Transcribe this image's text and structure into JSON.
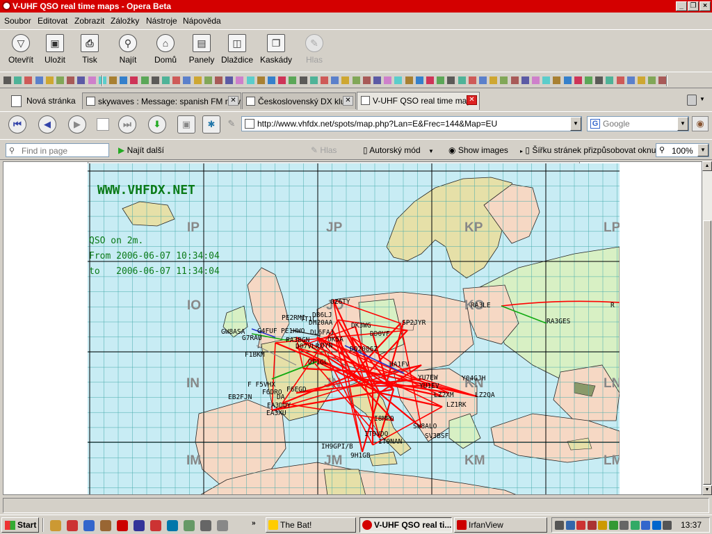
{
  "window": {
    "title": "V-UHF QSO real time maps - Opera Beta"
  },
  "menu": [
    "Soubor",
    "Editovat",
    "Zobrazit",
    "Záložky",
    "Nástroje",
    "Nápověda"
  ],
  "toolbar": {
    "open": "Otevřít",
    "save": "Uložit",
    "print": "Tisk",
    "find": "Najít",
    "home": "Domů",
    "panels": "Panely",
    "tile": "Dlaždice",
    "cascade": "Kaskády",
    "voice": "Hlas"
  },
  "tabs": {
    "new_page": "Nová stránka",
    "items": [
      {
        "title": "skywaves : Message: spanish FM now"
      },
      {
        "title": "Československý DX klub"
      },
      {
        "title": "V-UHF QSO real time maps"
      }
    ]
  },
  "address": {
    "url": "http://www.vhfdx.net/spots/map.php?Lan=E&Frec=144&Map=EU"
  },
  "search": {
    "engine": "Google"
  },
  "findbar": {
    "placeholder": "Find in page",
    "find_next": "Najít další",
    "voice": "Hlas",
    "author_mode": "Autorský mód",
    "show_images": "Show images",
    "fit_width": "Šířku stránek přizpůsobovat oknu",
    "zoom": "100%"
  },
  "map": {
    "site": "WWW.VHFDX.NET",
    "qso_line": "QSO on 2m.",
    "from_line": "From 2006-06-07 10:34:04",
    "to_line": "to   2006-06-07 11:34:04",
    "locators": [
      "IP",
      "JP",
      "KP",
      "LP",
      "IO",
      "JO",
      "KO",
      "IN",
      "JN",
      "KN",
      "LN",
      "IM",
      "JM",
      "KM",
      "LM"
    ],
    "stations": [
      "OZ6TY",
      "RA3LE",
      "R",
      "RA3GES",
      "PE2RMI",
      "TT1C",
      "DB6LJ",
      "DH20AA",
      "DK3WG",
      "DD0VF",
      "SP2JYR",
      "GW8ASA",
      "G4FUF",
      "PE1HWO",
      "DL6FAJ",
      "G7RAU",
      "PA3BGN",
      "OK5A",
      "D07VLR",
      "DYN",
      "DQ2006Z",
      "F1BKM",
      "DF1GL",
      "HA1FV",
      "YU7EW",
      "Y04GJH",
      "F F5VHX",
      "F6DRO",
      "F6EGD",
      "DA",
      "YU1EV",
      "EB2FJN",
      "EA3DUY",
      "LZ2XM",
      "LZ2QA",
      "LZ1RK",
      "EA3XU",
      "I8MPO",
      "SW8ALO",
      "SV3BSF",
      "IT9VDQ",
      "IT9NAN",
      "IH9GPI/B",
      "9H1GB"
    ]
  },
  "taskbar": {
    "start": "Start",
    "tasks": [
      "The Bat!",
      "V-UHF QSO real ti...",
      "IrfanView"
    ],
    "clock": "13:37"
  },
  "colors": {
    "titlebar": "#d40000",
    "map_sea": "#c8ecf4",
    "qso_line": "#ff0000"
  }
}
